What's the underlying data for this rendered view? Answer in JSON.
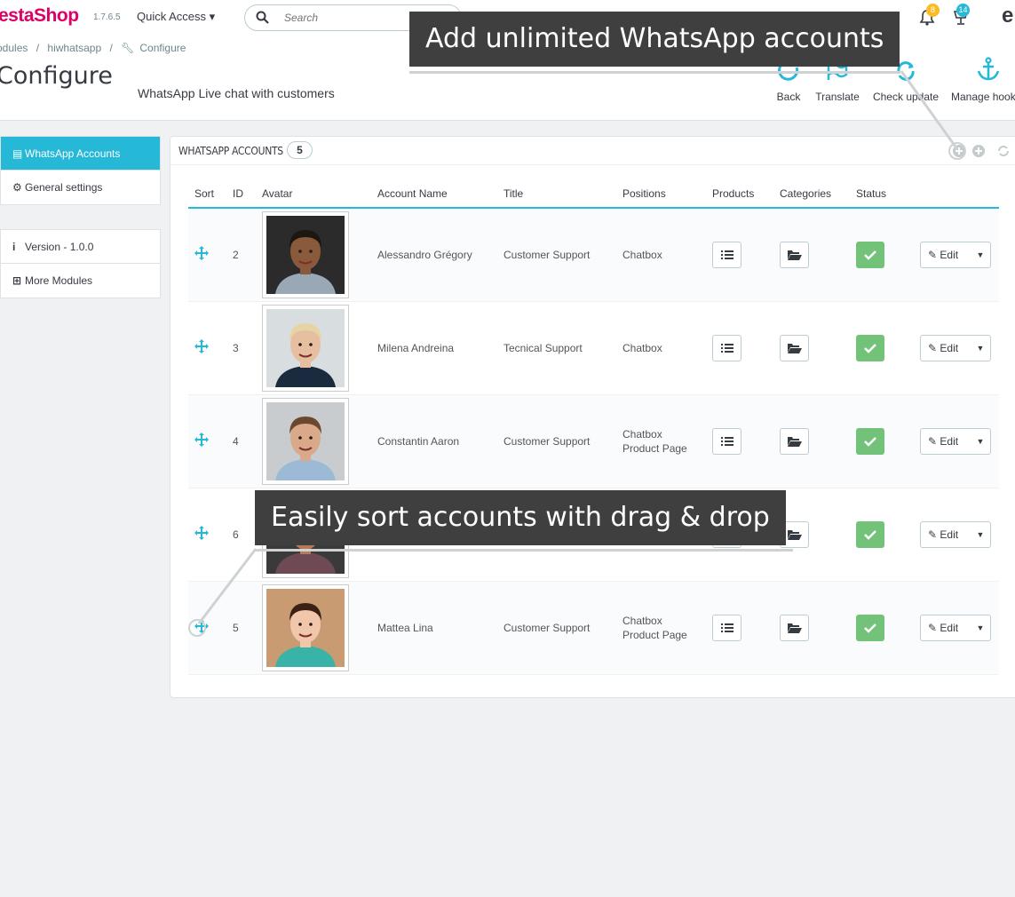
{
  "header": {
    "logo": "estaShop",
    "version": "1.7.6.5",
    "quick_access": "Quick Access ▾",
    "search_placeholder": "Search",
    "notif_orders": "8",
    "notif_customers": "14",
    "user_initial": "e"
  },
  "breadcrumb": [
    "odules",
    "/",
    "hiwhatsapp",
    "/",
    "Configure"
  ],
  "page": {
    "title": "Configure",
    "subtitle": "WhatsApp Live chat with customers"
  },
  "toolbar": {
    "back": "Back",
    "translate": "Translate",
    "check_update": "Check update",
    "manage_hooks": "Manage hooks"
  },
  "sidebar": {
    "items": [
      {
        "label": "WhatsApp Accounts",
        "active": true,
        "icon": "book-icon"
      },
      {
        "label": "General settings",
        "active": false,
        "icon": "gear-icon"
      }
    ],
    "items2": [
      {
        "label": "Version - 1.0.0",
        "icon": "info-icon"
      },
      {
        "label": "More Modules",
        "icon": "plus-square-icon"
      }
    ]
  },
  "panel": {
    "title": "WHATSAPP ACCOUNTS",
    "count": "5"
  },
  "table": {
    "headers": [
      "Sort",
      "ID",
      "Avatar",
      "Account Name",
      "Title",
      "Positions",
      "Products",
      "Categories",
      "Status",
      ""
    ],
    "edit_label": "Edit",
    "rows": [
      {
        "id": "2",
        "name": "Alessandro Grégory",
        "title": "Customer Support",
        "positions": "Chatbox",
        "positions2": "",
        "skin": "#8a5a3c",
        "hair": "#1e1611",
        "shirt": "#9aa7b5",
        "bg": "#2b2b2b"
      },
      {
        "id": "3",
        "name": "Milena Andreina",
        "title": "Tecnical Support",
        "positions": "Chatbox",
        "positions2": "",
        "skin": "#e6bfa1",
        "hair": "#e7d4a5",
        "shirt": "#1b2b3f",
        "bg": "#d8dde0"
      },
      {
        "id": "4",
        "name": "Constantin Aaron",
        "title": "Customer Support",
        "positions": "Chatbox",
        "positions2": "Product Page",
        "skin": "#d9a98a",
        "hair": "#6b4730",
        "shirt": "#9cb9d6",
        "bg": "#c9ccce"
      },
      {
        "id": "6",
        "name": "",
        "title": "",
        "positions": "",
        "positions2": "",
        "skin": "#b57a56",
        "hair": "#2a1a12",
        "shirt": "#6d4a54",
        "bg": "#3a3a3a"
      },
      {
        "id": "5",
        "name": "Mattea Lina",
        "title": "Customer Support",
        "positions": "Chatbox",
        "positions2": "Product Page",
        "skin": "#f0c7ab",
        "hair": "#3b2114",
        "shirt": "#39b3a7",
        "bg": "#c89b73"
      }
    ]
  },
  "callouts": {
    "top": "Add unlimited WhatsApp accounts",
    "middle": "Easily sort accounts with drag & drop"
  },
  "colors": {
    "accent": "#25b9d7",
    "status_green": "#72c279",
    "callout_bg": "#3f3f3f"
  }
}
